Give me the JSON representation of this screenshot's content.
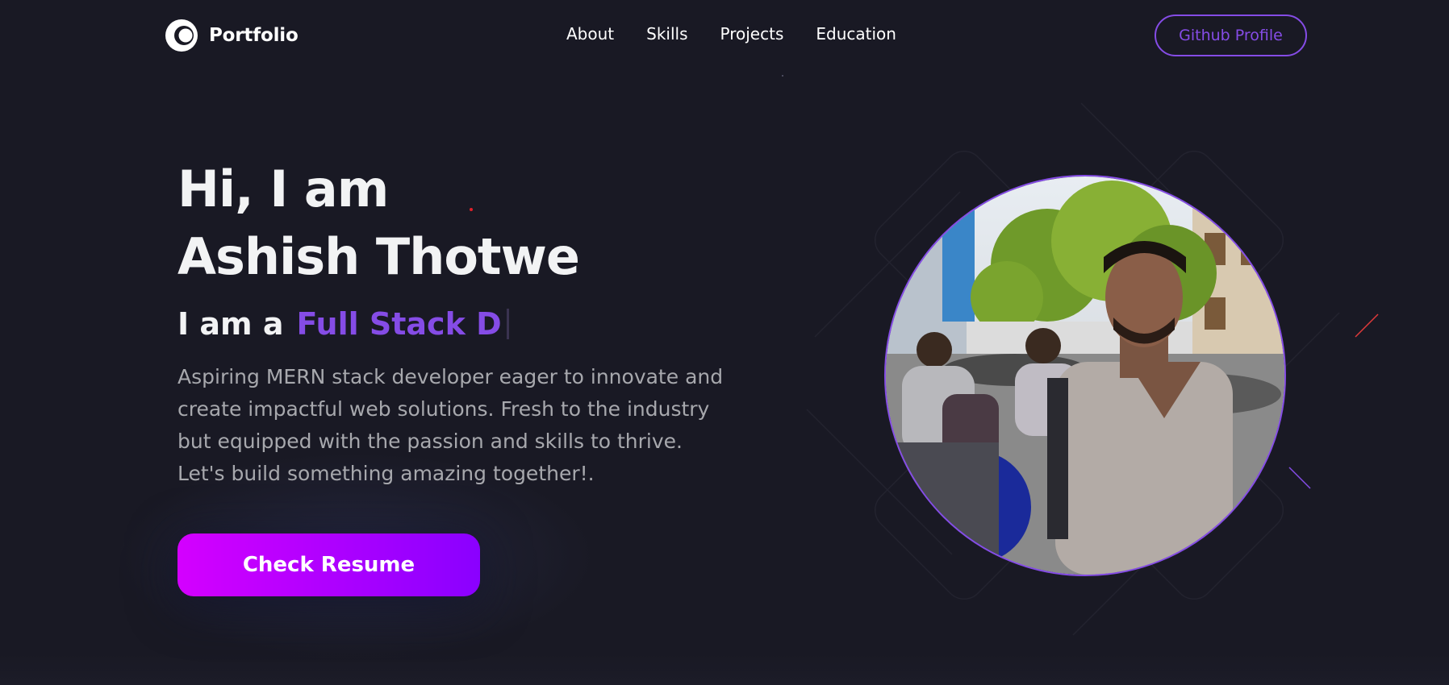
{
  "navbar": {
    "logo_text": "Portfolio",
    "links": [
      "About",
      "Skills",
      "Projects",
      "Education"
    ],
    "github_label": "Github Profile"
  },
  "hero": {
    "greeting": "Hi, I am",
    "name": "Ashish Thotwe",
    "role_prefix": "I am a",
    "role_typed": "Full Stack D",
    "bio": "Aspiring MERN stack developer eager to innovate and create impactful web solutions. Fresh to the industry but equipped with the passion and skills to thrive. Let's build something amazing together!.",
    "resume_label": "Check Resume"
  },
  "colors": {
    "background": "#191924",
    "accent": "#854ce6",
    "text_primary": "#f2f3f4",
    "text_secondary": "#a7a8ad",
    "button_gradient_start": "#d400ff",
    "button_gradient_end": "#8a00ff"
  }
}
